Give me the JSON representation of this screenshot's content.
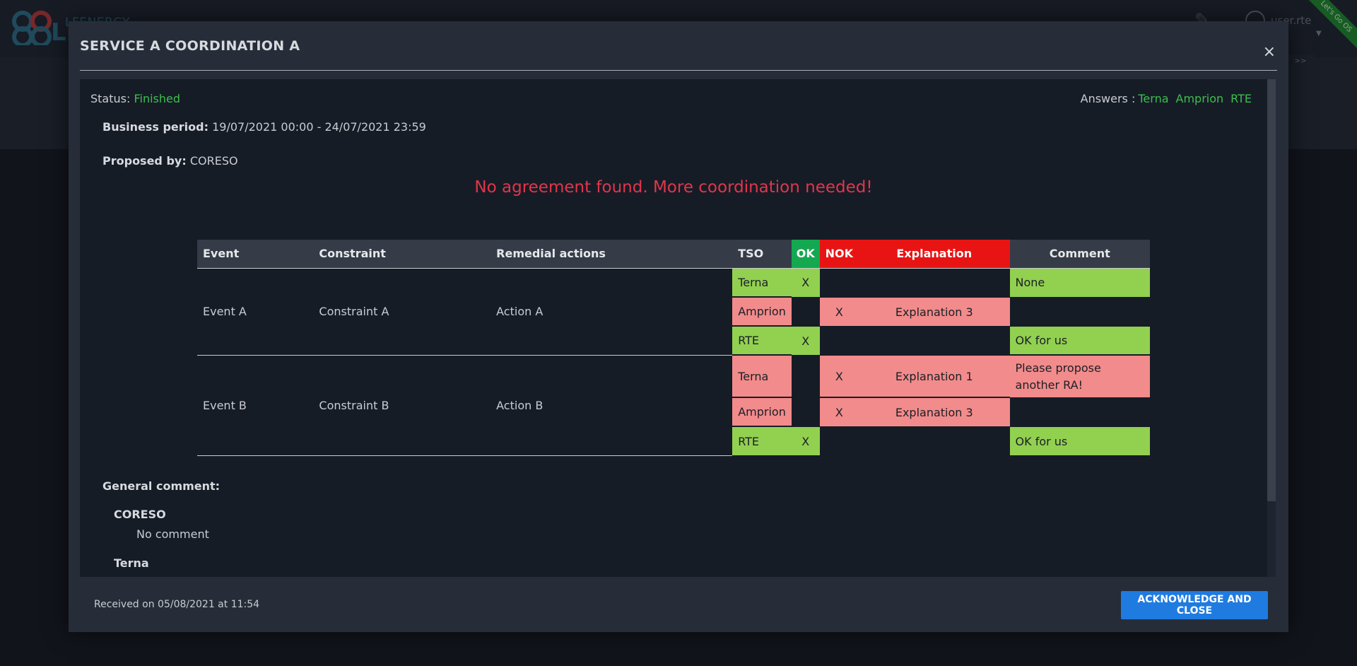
{
  "header": {
    "logo_text_top": "LFENERGY",
    "logo_text_bottom": "LE",
    "user_name": "user.rte",
    "ribbon_text": "Let's Go OS",
    "more_label": ">>"
  },
  "modal": {
    "title": "SERVICE A COORDINATION A",
    "close_label": "×",
    "status_label": "Status:",
    "status_value": "Finished",
    "answers_label": "Answers :",
    "answers": [
      "Terna",
      "Amprion",
      "RTE"
    ],
    "business_period_label": "Business period:",
    "business_period_value": "19/07/2021 00:00 - 24/07/2021 23:59",
    "proposed_by_label": "Proposed by:",
    "proposed_by_value": "CORESO",
    "warning": "No agreement found. More coordination needed!",
    "table": {
      "headers": {
        "event": "Event",
        "constraint": "Constraint",
        "remedial": "Remedial actions",
        "tso": "TSO",
        "ok": "OK",
        "nok": "NOK",
        "explanation": "Explanation",
        "comment": "Comment"
      },
      "groups": [
        {
          "event": "Event A",
          "constraint": "Constraint A",
          "action": "Action A",
          "rows": [
            {
              "tso": "Terna",
              "ok": "X",
              "nok": "",
              "explanation": "",
              "comment": "None"
            },
            {
              "tso": "Amprion",
              "ok": "",
              "nok": "X",
              "explanation": "Explanation 3",
              "comment": ""
            },
            {
              "tso": "RTE",
              "ok": "X",
              "nok": "",
              "explanation": "",
              "comment": "OK for us"
            }
          ]
        },
        {
          "event": "Event B",
          "constraint": "Constraint B",
          "action": "Action B",
          "rows": [
            {
              "tso": "Terna",
              "ok": "",
              "nok": "X",
              "explanation": "Explanation 1",
              "comment": "Please propose another RA!"
            },
            {
              "tso": "Amprion",
              "ok": "",
              "nok": "X",
              "explanation": "Explanation 3",
              "comment": ""
            },
            {
              "tso": "RTE",
              "ok": "X",
              "nok": "",
              "explanation": "",
              "comment": "OK for us"
            }
          ]
        }
      ]
    },
    "general_comment_label": "General comment:",
    "comments": [
      {
        "author": "CORESO",
        "text": "No comment"
      },
      {
        "author": "Terna",
        "text": ""
      }
    ],
    "received": "Received on 05/08/2021 at 11:54",
    "ack_button": "ACKNOWLEDGE AND CLOSE"
  },
  "colors": {
    "ok_green": "#92d050",
    "nok_red": "#f28b8b",
    "header_ok": "#14a850",
    "header_nok": "#e81414",
    "warning": "#e0364b",
    "status_green": "#3bbf4e",
    "button_blue": "#1f7be0"
  }
}
